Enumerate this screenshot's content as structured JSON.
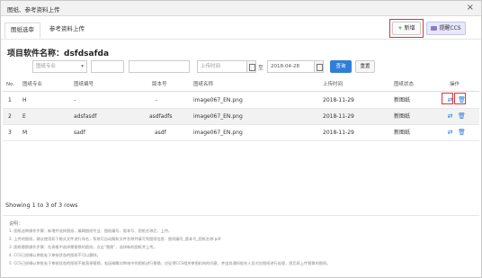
{
  "window": {
    "title": "图纸、参考资料上传",
    "close_glyph": "×"
  },
  "tabs": [
    {
      "label": "图纸选审"
    },
    {
      "label": "参考资料上传"
    }
  ],
  "toolbar": {
    "new_label": "新增",
    "ccs_label": "提醒CCS"
  },
  "project": {
    "title": "项目软件名称：dsfdsafda"
  },
  "filters": {
    "major_placeholder": "图纸专业",
    "field2_value": "",
    "field3_value": "",
    "start_time_placeholder": "上传时间",
    "separator": "至",
    "end_date_value": "2018-04-28",
    "query_label": "查询",
    "reset_label": "重置"
  },
  "table": {
    "columns": [
      "No.",
      "图纸专业",
      "图纸编号",
      "版本号",
      "图纸名称",
      "上传时间",
      "图纸状态",
      "操作"
    ],
    "rows": [
      {
        "no": "1",
        "major": "H",
        "number": "-",
        "version": "-",
        "name": "image067_EN.png",
        "time": "2018-11-29",
        "status": "新图纸"
      },
      {
        "no": "2",
        "major": "E",
        "number": "adsfasdf",
        "version": "asdfadfs",
        "name": "image067_EN.png",
        "time": "2018-11-29",
        "status": "新图纸"
      },
      {
        "no": "3",
        "major": "M",
        "number": "sadf",
        "version": "asdf",
        "name": "image067_EN.png",
        "time": "2018-11-29",
        "status": "新图纸"
      }
    ]
  },
  "footer": {
    "showing": "Showing 1 to 3 of 3 rows"
  },
  "notes": {
    "title": "说明：",
    "items": [
      "1. 图纸送审操作步骤：新增并选择图纸，编辑图纸专业、图纸编号、版本号、图纸名称后，上传。",
      "2. 上传的图纸，建议使用如下格式文件进行命名，系统可自动解析文件名称并填写到图纸信息：图纸编号_版本号_图纸名称.pdf",
      "3. 图纸替换操作步骤：在表格中选择需替换的图纸，点击“替换”，选择新的图纸并上传。",
      "4. CCS已经确认审批处于审核状态的图纸不可以删除。",
      "5. CCS已经确认审批处于审核状态的图纸不能直接替换，若因确需对审核中的图纸进行替换，应征得CCS相关审图机构的同意，并由其通知船东人员对应图纸进行处理，然后再上传替换的图纸。"
    ]
  },
  "icons": {
    "edit": "swap-icon",
    "delete": "trash-icon"
  }
}
